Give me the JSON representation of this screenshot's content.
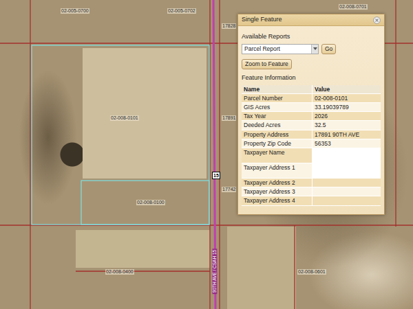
{
  "map": {
    "labels": [
      {
        "text": "02-005-0700"
      },
      {
        "text": "02-005-0702"
      },
      {
        "text": "17828"
      },
      {
        "text": "02-008-0101"
      },
      {
        "text": "17891"
      },
      {
        "text": "02-008-0100"
      },
      {
        "text": "17742"
      },
      {
        "text": "02-008-0400"
      },
      {
        "text": "02-008-0601"
      },
      {
        "text": "02-008-0701"
      }
    ],
    "route_shield": "15",
    "road_label": "90TH AVE / CSAH 15"
  },
  "popup": {
    "title": "Single Feature",
    "reports_label": "Available Reports",
    "report_select": "Parcel Report",
    "go_button": "Go",
    "zoom_button": "Zoom to Feature",
    "section_title": "Feature Information",
    "columns": [
      "Name",
      "Value"
    ],
    "rows": [
      {
        "name": "Parcel Number",
        "value": "02-008-0101",
        "redacted": false
      },
      {
        "name": "GIS Acres",
        "value": "33.19039789",
        "redacted": false
      },
      {
        "name": "Tax Year",
        "value": "2026",
        "redacted": false
      },
      {
        "name": "Deeded Acres",
        "value": "32.5",
        "redacted": false
      },
      {
        "name": "Property Address",
        "value": "17891 90TH AVE",
        "redacted": false
      },
      {
        "name": "Property Zip Code",
        "value": "56353",
        "redacted": false
      },
      {
        "name": "Taxpayer Name",
        "value": "",
        "redacted": true
      },
      {
        "name": "Taxpayer Address 1",
        "value": "",
        "redacted": true
      },
      {
        "name": "Taxpayer Address 2",
        "value": "",
        "redacted": false
      },
      {
        "name": "Taxpayer Address 3",
        "value": "",
        "redacted": false
      },
      {
        "name": "Taxpayer Address 4",
        "value": "",
        "redacted": false
      }
    ]
  }
}
